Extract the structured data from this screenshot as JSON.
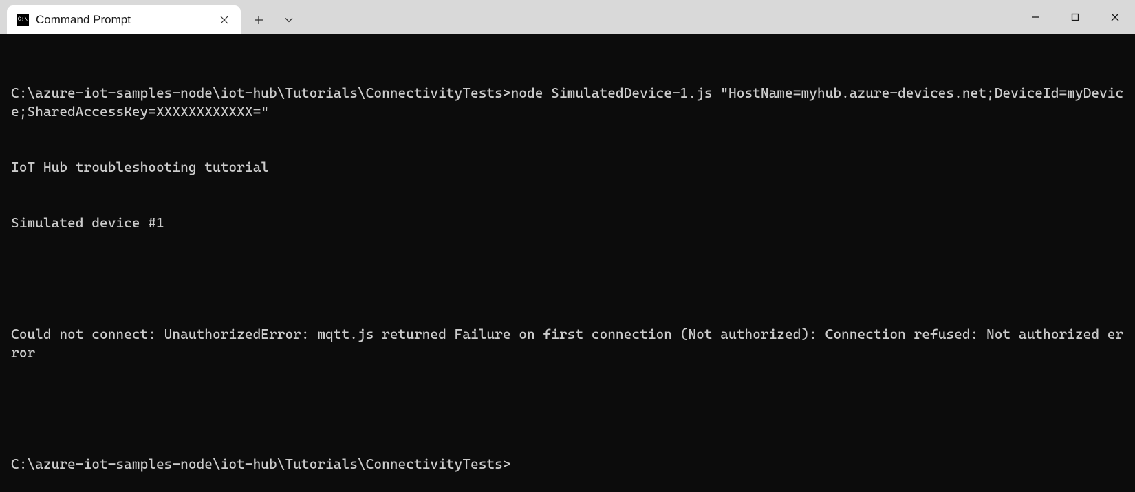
{
  "titlebar": {
    "tab_title": "Command Prompt"
  },
  "terminal": {
    "lines": [
      "C:\\azure-iot-samples-node\\iot-hub\\Tutorials\\ConnectivityTests>node SimulatedDevice-1.js \"HostName=myhub.azure-devices.net;DeviceId=myDevice;SharedAccessKey=XXXXXXXXXXXX=\"",
      "IoT Hub troubleshooting tutorial",
      "Simulated device #1",
      "",
      "Could not connect: UnauthorizedError: mqtt.js returned Failure on first connection (Not authorized): Connection refused: Not authorized error",
      "",
      "C:\\azure-iot-samples-node\\iot-hub\\Tutorials\\ConnectivityTests>"
    ]
  }
}
